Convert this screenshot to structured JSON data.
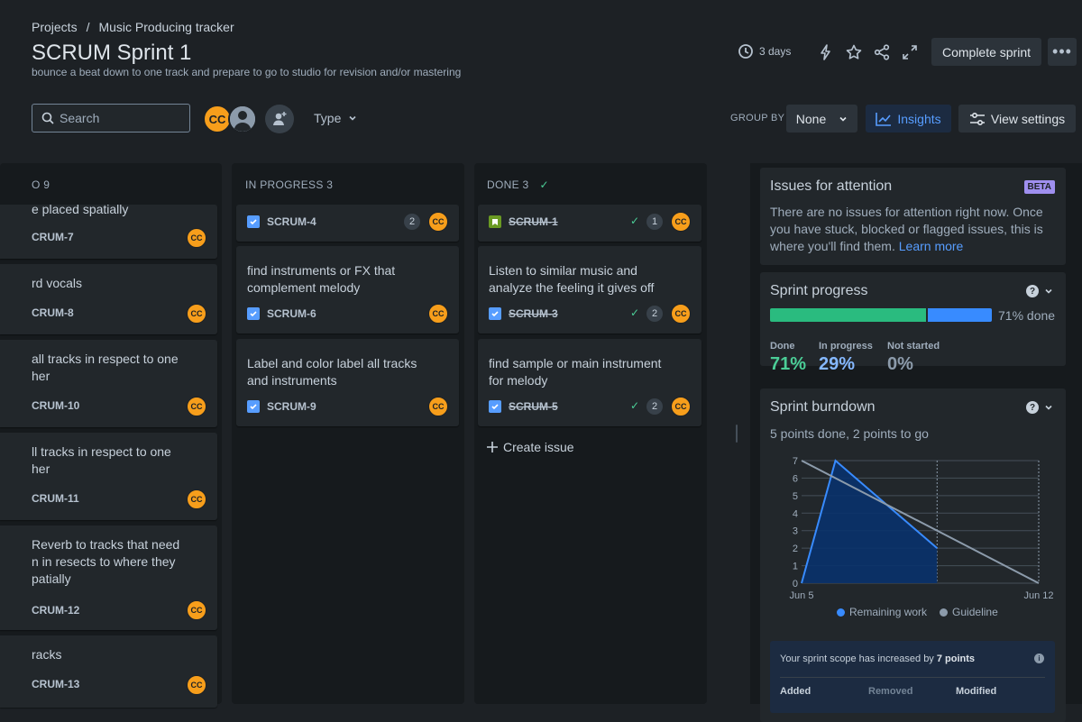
{
  "breadcrumbs": [
    "Projects",
    "/",
    "Music Producing tracker"
  ],
  "sprint": {
    "title": "SCRUM Sprint 1",
    "goal": "bounce a beat down to one track and prepare to go to studio for revision and/or mastering",
    "days_remaining": "3 days",
    "complete_label": "Complete sprint"
  },
  "toolbar": {
    "search_placeholder": "Search",
    "avatar_initials": "CC",
    "type_label": "Type",
    "group_by_label": "GROUP BY",
    "group_by_value": "None",
    "insights_label": "Insights",
    "view_settings_label": "View settings"
  },
  "columns": {
    "todo": {
      "header": "O 9",
      "cards": [
        {
          "title": "e placed spatially",
          "key": "CRUM-7"
        },
        {
          "title": "rd vocals",
          "key": "CRUM-8"
        },
        {
          "title": "all tracks in respect to one\nher",
          "key": "CRUM-10"
        },
        {
          "title": "ll tracks in respect to one\nher",
          "key": "CRUM-11"
        },
        {
          "title": "Reverb to tracks that need\nn in resects to where they\npatially",
          "key": "CRUM-12"
        },
        {
          "title": "racks",
          "key": "CRUM-13"
        }
      ]
    },
    "in_progress": {
      "header": "IN PROGRESS 3",
      "cards": [
        {
          "title": "",
          "key": "SCRUM-4",
          "points": "2"
        },
        {
          "title": "find instruments or FX that complement melody",
          "key": "SCRUM-6"
        },
        {
          "title": "Label and color label all tracks and instruments",
          "key": "SCRUM-9"
        }
      ]
    },
    "done": {
      "header": "DONE 3",
      "cards": [
        {
          "title": "",
          "key": "SCRUM-1",
          "points": "1"
        },
        {
          "title": "Listen to similar music and analyze the feeling it gives off",
          "key": "SCRUM-3",
          "points": "2"
        },
        {
          "title": "find sample or main instrument for melody",
          "key": "SCRUM-5",
          "points": "2"
        }
      ],
      "create_label": "Create issue"
    }
  },
  "insights": {
    "attention": {
      "title": "Issues for attention",
      "badge": "BETA",
      "text": "There are no issues for attention right now. Once you have stuck, blocked or flagged issues, this is where you'll find them.",
      "link": "Learn more"
    },
    "progress": {
      "title": "Sprint progress",
      "done_fraction": 0.71,
      "in_progress_fraction": 0.29,
      "summary": "71% done",
      "stats": [
        {
          "label": "Done",
          "value": "71%",
          "color": "#4bce97"
        },
        {
          "label": "In progress",
          "value": "29%",
          "color": "#85b8ff"
        },
        {
          "label": "Not started",
          "value": "0%",
          "color": "#8c9bab"
        }
      ]
    },
    "burndown": {
      "title": "Sprint burndown",
      "subtitle": "5 points done, 2 points to go",
      "legend_remaining": "Remaining work",
      "legend_guideline": "Guideline"
    },
    "scope": {
      "text_prefix": "Your sprint scope has increased by",
      "text_value": "7 points",
      "columns": [
        "Added",
        "Removed",
        "Modified"
      ]
    }
  },
  "chart_data": {
    "type": "line",
    "x_labels": [
      "Jun 5",
      "Jun 12"
    ],
    "ylim": [
      0,
      7
    ],
    "yticks": [
      0,
      1,
      2,
      3,
      4,
      5,
      6,
      7
    ],
    "series": [
      {
        "name": "Remaining work",
        "color": "#388bff",
        "points": [
          [
            0,
            0
          ],
          [
            1,
            7
          ],
          [
            4,
            2
          ]
        ]
      },
      {
        "name": "Guideline",
        "color": "#8c9bab",
        "points": [
          [
            0,
            7
          ],
          [
            7,
            0
          ]
        ]
      }
    ],
    "x_domain": [
      0,
      7
    ],
    "today_x": 4
  }
}
